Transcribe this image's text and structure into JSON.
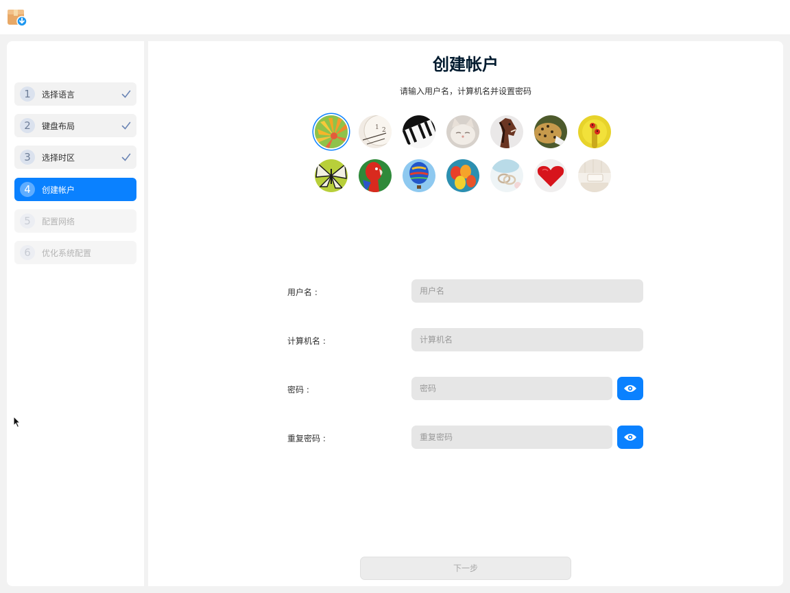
{
  "sidebar": {
    "steps": [
      {
        "num": "1",
        "label": "选择语言",
        "state": "done"
      },
      {
        "num": "2",
        "label": "键盘布局",
        "state": "done"
      },
      {
        "num": "3",
        "label": "选择时区",
        "state": "done"
      },
      {
        "num": "4",
        "label": "创建帐户",
        "state": "active"
      },
      {
        "num": "5",
        "label": "配置网络",
        "state": "pending"
      },
      {
        "num": "6",
        "label": "优化系统配置",
        "state": "pending"
      }
    ]
  },
  "main": {
    "title": "创建帐户",
    "subtitle": "请输入用户名，计算机名并设置密码",
    "avatars": [
      "flower",
      "clock",
      "piano",
      "kitten",
      "horse",
      "leopard",
      "ladybug",
      "butterfly",
      "parrot",
      "hot-air-balloon",
      "balloons",
      "rings",
      "heart",
      "room"
    ],
    "selected_avatar": "flower"
  },
  "form": {
    "username": {
      "label": "用户名 :",
      "placeholder": "用户名",
      "value": ""
    },
    "hostname": {
      "label": "计算机名 :",
      "placeholder": "计算机名",
      "value": ""
    },
    "password": {
      "label": "密码 :",
      "placeholder": "密码",
      "value": ""
    },
    "repeat_password": {
      "label": "重复密码 :",
      "placeholder": "重复密码",
      "value": ""
    }
  },
  "next_button": {
    "label": "下一步",
    "enabled": false
  },
  "icons": {
    "app": "installer-package-icon",
    "done": "checkmark-icon",
    "reveal": "eye-icon"
  },
  "colors": {
    "accent": "#0a81ff",
    "title": "#001a2e",
    "background": "#f2f2f2"
  }
}
